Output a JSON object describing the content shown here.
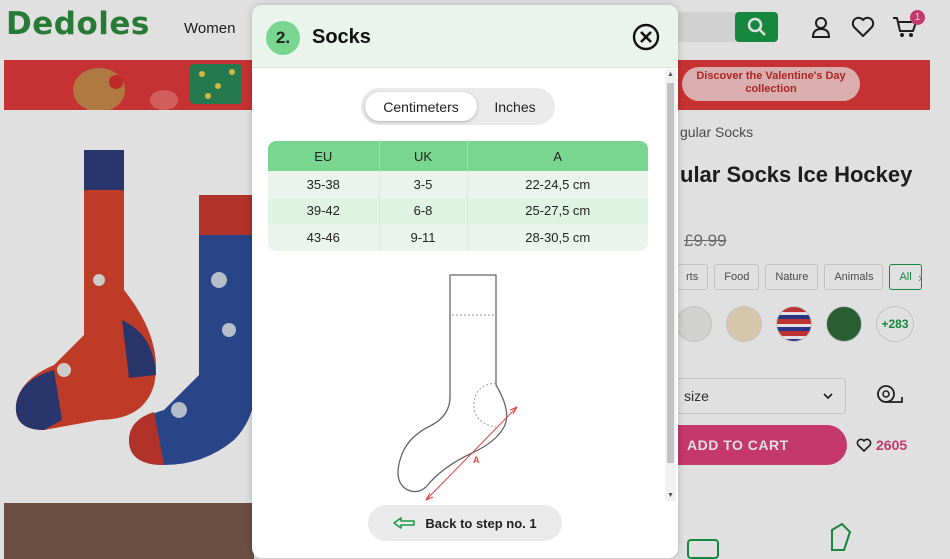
{
  "header": {
    "logo": "Dedoles",
    "nav_women": "Women",
    "cart_count": "1"
  },
  "banner": {
    "button_text": "Discover the Valentine's Day collection"
  },
  "product": {
    "breadcrumb": "gular Socks",
    "title": "ular Socks Ice Hockey",
    "old_price": "£9.99",
    "categories": [
      "rts",
      "Food",
      "Nature",
      "Animals",
      "All"
    ],
    "more_designs": "+283",
    "size_placeholder": "size",
    "add_to_cart": "ADD TO CART",
    "wishlist_count": "2605"
  },
  "modal": {
    "step": "2.",
    "title": "Socks",
    "units": {
      "centimeters": "Centimeters",
      "inches": "Inches",
      "selected": "Centimeters"
    },
    "table": {
      "headers": [
        "EU",
        "UK",
        "A"
      ],
      "rows": [
        [
          "35-38",
          "3-5",
          "22-24,5 cm"
        ],
        [
          "39-42",
          "6-8",
          "25-27,5 cm"
        ],
        [
          "43-46",
          "9-11",
          "28-30,5 cm"
        ]
      ]
    },
    "diagram_label": "A",
    "back_button": "Back to step no. 1"
  },
  "colors": {
    "brand_green": "#1a9a48",
    "table_header": "#79d691",
    "accent_pink": "#e0407b"
  }
}
